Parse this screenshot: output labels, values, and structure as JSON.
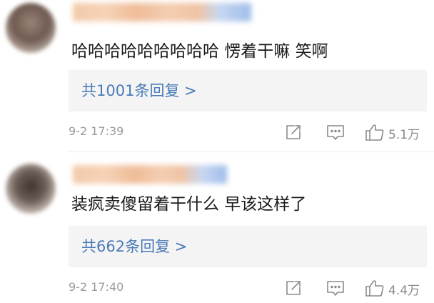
{
  "comments": [
    {
      "text": "哈哈哈哈哈哈哈哈哈 愣着干嘛 笑啊",
      "reply_link": "共1001条回复 >",
      "timestamp": "9-2 17:39",
      "like_count": "5.1万"
    },
    {
      "text": "装疯卖傻留着干什么 早该这样了",
      "reply_link": "共662条回复 >",
      "timestamp": "9-2 17:40",
      "like_count": "4.4万"
    }
  ],
  "icons": {
    "share": "share-icon",
    "comment": "comment-icon",
    "like": "thumbs-up-icon"
  },
  "colors": {
    "reply_link": "#4a7bb7",
    "reply_bg": "#f4f4f4",
    "meta_gray": "#9a9a9a"
  }
}
